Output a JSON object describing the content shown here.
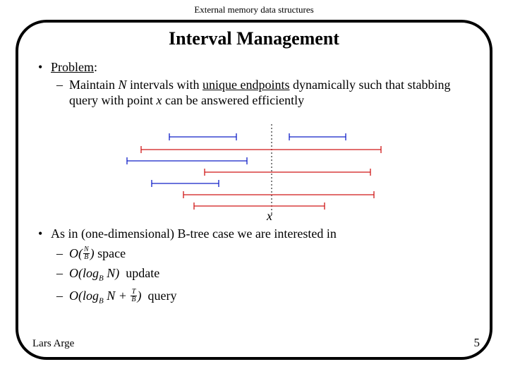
{
  "header": "External memory data structures",
  "title": "Interval Management",
  "bullet1_lead": "Problem",
  "bullet1_colon": ":",
  "sub1_prefix": "Maintain ",
  "sub1_N": "N",
  "sub1_mid1": " intervals with ",
  "sub1_under": "unique endpoints",
  "sub1_mid2": " dynamically such that stabbing query with point ",
  "sub1_x": "x",
  "sub1_tail": " can be answered efficiently",
  "x_label": "x",
  "bullet2": "As in (one-dimensional) B-tree case we are interested in",
  "space_word": "space",
  "update_word": "update",
  "query_word": "query",
  "footer_author": "Lars Arge",
  "footer_page": "5",
  "math": {
    "O": "O",
    "log": "log",
    "N": "N",
    "B": "B",
    "T": "T",
    "plus": "+"
  }
}
